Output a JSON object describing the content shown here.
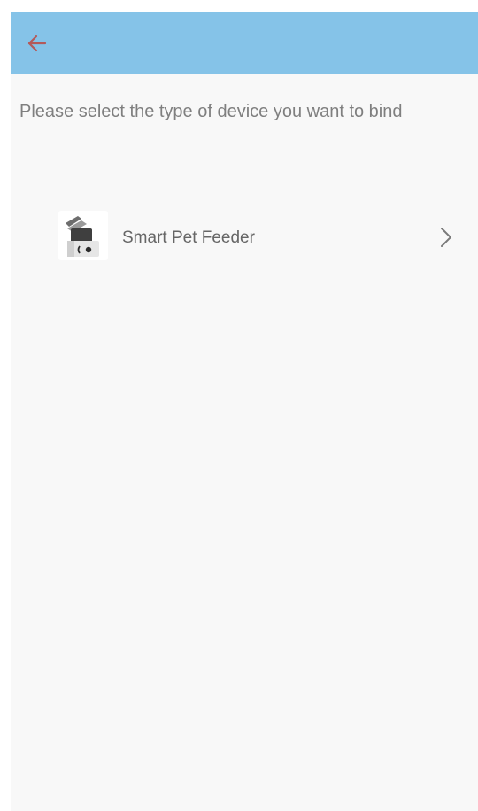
{
  "colors": {
    "header_bg": "#85c3e8",
    "back_arrow": "#b35a5a",
    "page_bg": "#f8f8f8",
    "text_muted": "#7f7f7f"
  },
  "header": {
    "back_icon": "arrow-left-icon"
  },
  "main": {
    "prompt": "Please select the type of device you want to bind",
    "devices": [
      {
        "label": "Smart Pet Feeder",
        "thumbnail_icon": "pet-feeder-icon",
        "chevron_icon": "chevron-right-icon"
      }
    ]
  }
}
